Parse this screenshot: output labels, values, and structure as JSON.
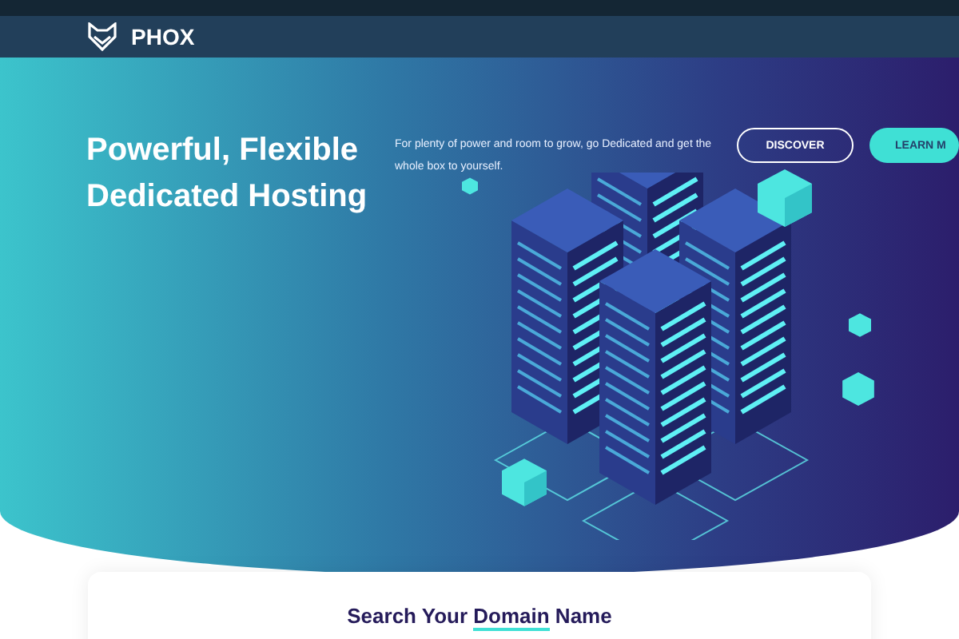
{
  "nav": {
    "brand": "PHOX"
  },
  "hero": {
    "title_lines": [
      "Powerful, Flexible",
      "Dedicated Hosting"
    ],
    "description": "For plenty of power and room to grow, go Dedicated and get the whole box to yourself.",
    "buttons": [
      {
        "label": "DISCOVER",
        "kind": "outline"
      },
      {
        "label": "LEARN M",
        "kind": "filled"
      }
    ]
  },
  "search_card": {
    "heading": [
      "Search Your",
      "Domain",
      "Name"
    ]
  }
}
